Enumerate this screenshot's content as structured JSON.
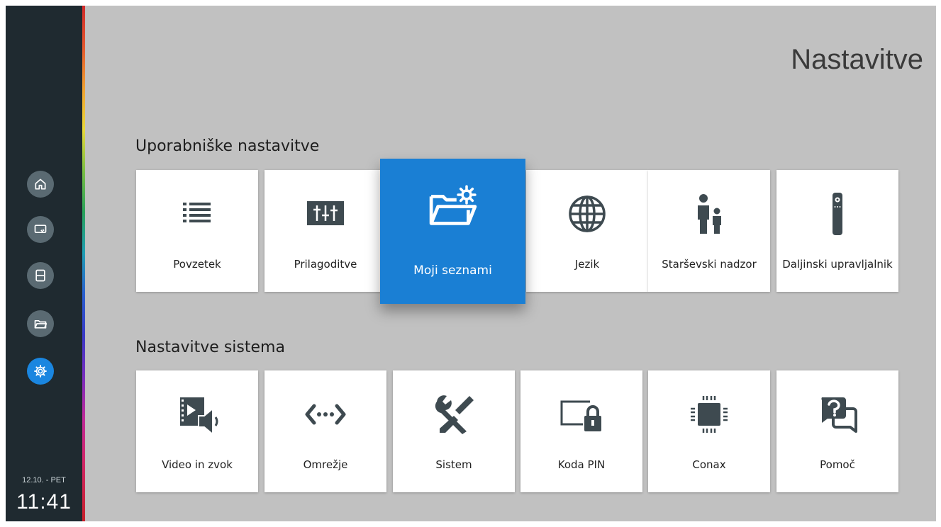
{
  "page_title": "Nastavitve",
  "sidebar": {
    "items": [
      {
        "icon": "home-icon"
      },
      {
        "icon": "tv-guide-icon"
      },
      {
        "icon": "film-icon"
      },
      {
        "icon": "folder-icon"
      },
      {
        "icon": "gear-icon",
        "active": true
      }
    ],
    "date": "12.10. - PET",
    "time": "11:41"
  },
  "sections": [
    {
      "title": "Uporabniške nastavitve",
      "tiles": [
        {
          "label": "Povzetek",
          "icon": "list-icon"
        },
        {
          "label": "Prilagoditve",
          "icon": "sliders-icon"
        },
        {
          "label": "Moji seznami",
          "icon": "folder-settings-icon",
          "focused": true
        },
        {
          "label": "Jezik",
          "icon": "globe-icon"
        },
        {
          "label": "Starševski nadzor",
          "icon": "parent-child-icon"
        },
        {
          "label": "Daljinski upravljalnik",
          "icon": "remote-control-icon"
        }
      ]
    },
    {
      "title": "Nastavitve sistema",
      "tiles": [
        {
          "label": "Video in zvok",
          "icon": "video-audio-icon"
        },
        {
          "label": "Omrežje",
          "icon": "network-icon"
        },
        {
          "label": "Sistem",
          "icon": "tools-icon"
        },
        {
          "label": "Koda PIN",
          "icon": "pin-lock-icon"
        },
        {
          "label": "Conax",
          "icon": "chip-icon"
        },
        {
          "label": "Pomoč",
          "icon": "help-icon"
        }
      ]
    }
  ],
  "colors": {
    "accent": "#1a7fd4",
    "background": "#c1c1c1",
    "sidebar": "#1f2a30",
    "icon": "#3e4a50"
  }
}
